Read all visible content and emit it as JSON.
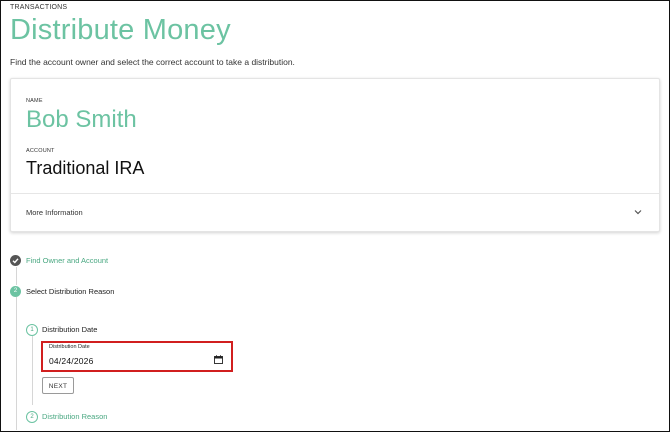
{
  "header": {
    "breadcrumb": "TRANSACTIONS",
    "title": "Distribute Money",
    "subtitle": "Find the account owner and select the correct account to take a distribution."
  },
  "owner_card": {
    "name_label": "NAME",
    "name": "Bob Smith",
    "account_label": "ACCOUNT",
    "account": "Traditional IRA",
    "more_info": "More Information"
  },
  "steps": [
    {
      "number": "",
      "label": "Find Owner and Account",
      "state": "complete"
    },
    {
      "number": "2",
      "label": "Select Distribution Reason",
      "state": "active"
    }
  ],
  "substeps": [
    {
      "number": "1",
      "label": "Distribution Date",
      "state": "active"
    },
    {
      "number": "2",
      "label": "Distribution Reason",
      "state": "pending"
    }
  ],
  "date_field": {
    "label": "Distribution Date",
    "value": "04/24/2026"
  },
  "next_button": "NEXT",
  "colors": {
    "accent": "#6cc3a2",
    "accent_dark": "#4aa882",
    "highlight": "#d11f1f",
    "complete_dot": "#555555"
  },
  "icons": {
    "step_complete": "check-icon",
    "expand": "chevron-down-icon",
    "calendar": "calendar-icon"
  }
}
